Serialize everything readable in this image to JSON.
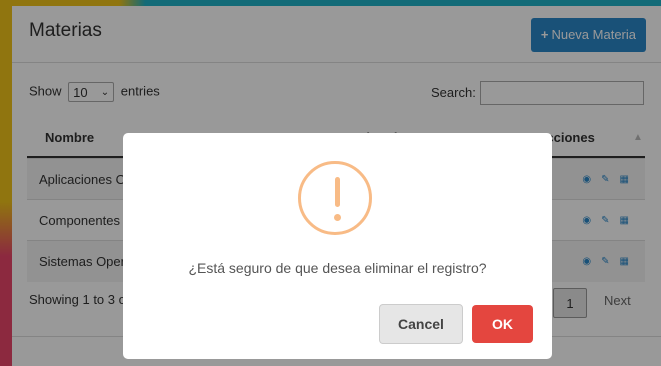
{
  "panel": {
    "title": "Materias",
    "new_button": "Nueva Materia"
  },
  "controls": {
    "show_label": "Show",
    "entries_value": "10",
    "entries_label": "entries",
    "search_label": "Search:"
  },
  "table": {
    "columns": [
      "Nombre",
      "Abreviatura",
      "Acciones"
    ],
    "rows": [
      {
        "nombre": "Aplicaciones O"
      },
      {
        "nombre": "Componentes"
      },
      {
        "nombre": "Sistemas Oper"
      }
    ]
  },
  "footer": {
    "info": "Showing 1 to 3 o",
    "current_page": "1",
    "next_label": "Next"
  },
  "dialog": {
    "message": "¿Está seguro de que desea eliminar el registro?",
    "cancel_label": "Cancel",
    "ok_label": "OK",
    "icon": "warning-icon"
  },
  "colors": {
    "primary": "#2a87c9",
    "danger": "#e4463f",
    "warning": "#f8bb86"
  }
}
